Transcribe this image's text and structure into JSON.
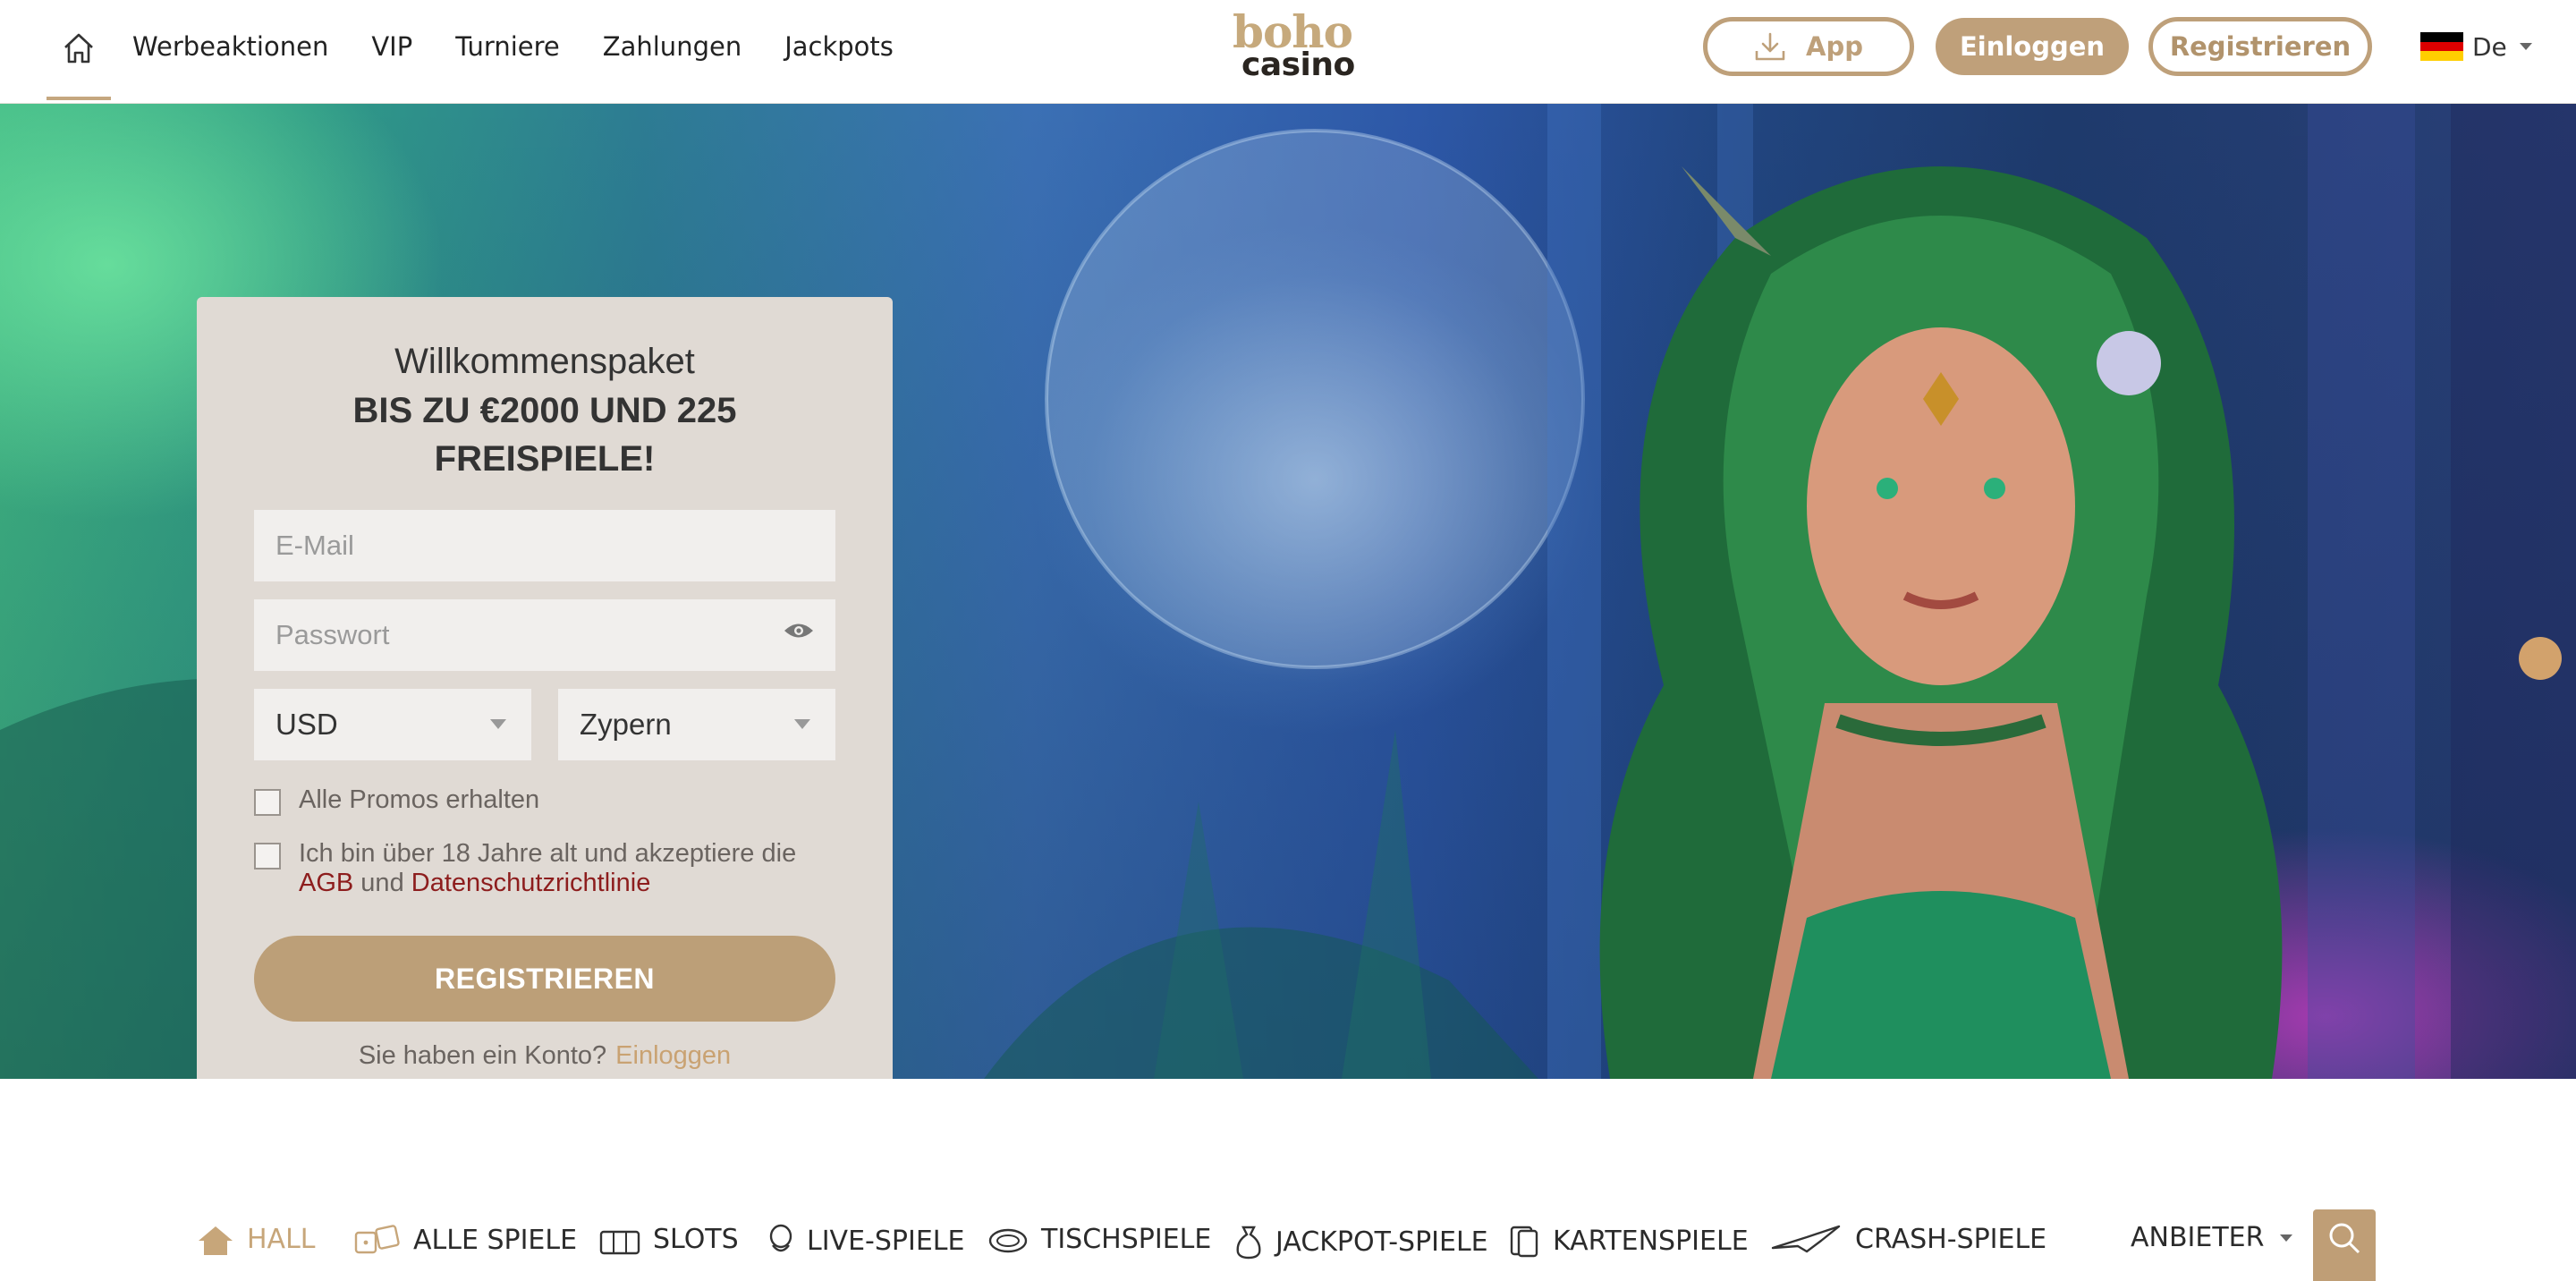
{
  "header": {
    "nav": [
      "Werbeaktionen",
      "VIP",
      "Turniere",
      "Zahlungen",
      "Jackpots"
    ],
    "logo_top": "boho",
    "logo_bottom": "casino",
    "app_label": "App",
    "login_label": "Einloggen",
    "register_label": "Registrieren",
    "language": "De"
  },
  "card": {
    "title": "Willkommenspaket",
    "subtitle": "BIS ZU €2000 UND 225 FREISPIELE!",
    "email_placeholder": "E-Mail",
    "password_placeholder": "Passwort",
    "currency": "USD",
    "country": "Zypern",
    "promos_label": "Alle Promos erhalten",
    "terms_prefix": "Ich bin über 18 Jahre alt und akzeptiere die ",
    "terms_agb": "AGB",
    "terms_and": " und ",
    "terms_privacy": "Datenschutzrichtlinie",
    "submit_label": "REGISTRIEREN",
    "have_account": "Sie haben ein Konto?",
    "login_link": "Einloggen"
  },
  "categories": [
    "HALL",
    "ALLE SPIELE",
    "SLOTS",
    "LIVE-SPIELE",
    "TISCHSPIELE",
    "JACKPOT-SPIELE",
    "KARTENSPIELE",
    "CRASH-SPIELE"
  ],
  "providers_label": "ANBIETER",
  "colors": {
    "brand_gold": "#bfa07a",
    "link_red": "#8d1d1d",
    "active_category": "#c7a67a"
  }
}
